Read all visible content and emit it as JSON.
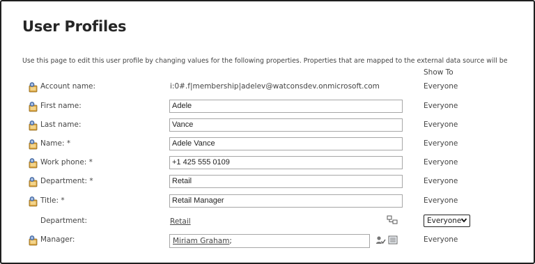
{
  "page": {
    "title": "User Profiles",
    "description": "Use this page to edit this user profile by changing values for the following properties. Properties that are mapped to the external data source will be",
    "show_to_header": "Show To"
  },
  "rows": [
    {
      "label": "Account name:",
      "icon": "user-profile-icon",
      "value": "i:0#.f|membership|adelev@watconsdev.onmicrosoft.com",
      "show_to": "Everyone"
    },
    {
      "label": "First name:",
      "icon": "user-profile-icon",
      "value": "Adele",
      "show_to": "Everyone"
    },
    {
      "label": "Last name:",
      "icon": "user-profile-icon",
      "value": "Vance",
      "show_to": "Everyone"
    },
    {
      "label": "Name: *",
      "icon": "user-profile-icon",
      "value": "Adele Vance",
      "show_to": "Everyone"
    },
    {
      "label": "Work phone: *",
      "icon": "user-profile-icon",
      "value": "+1 425 555 0109",
      "show_to": "Everyone"
    },
    {
      "label": "Department: *",
      "icon": "user-profile-icon",
      "value": "Retail",
      "show_to": "Everyone"
    },
    {
      "label": "Title: *",
      "icon": "user-profile-icon",
      "value": "Retail Manager",
      "show_to": "Everyone"
    },
    {
      "label": "Department:",
      "icon": "term-picker-icon",
      "value": "Retail",
      "show_to": "Everyone",
      "show_to_control": "dropdown"
    },
    {
      "label": "Manager:",
      "icon": "user-profile-icon",
      "value": "Miriam Graham",
      "value_suffix": ";",
      "show_to": "Everyone"
    }
  ],
  "colors": {
    "border": "#1f1f1f",
    "text": "#444444",
    "input_border": "#a6a6a6"
  }
}
